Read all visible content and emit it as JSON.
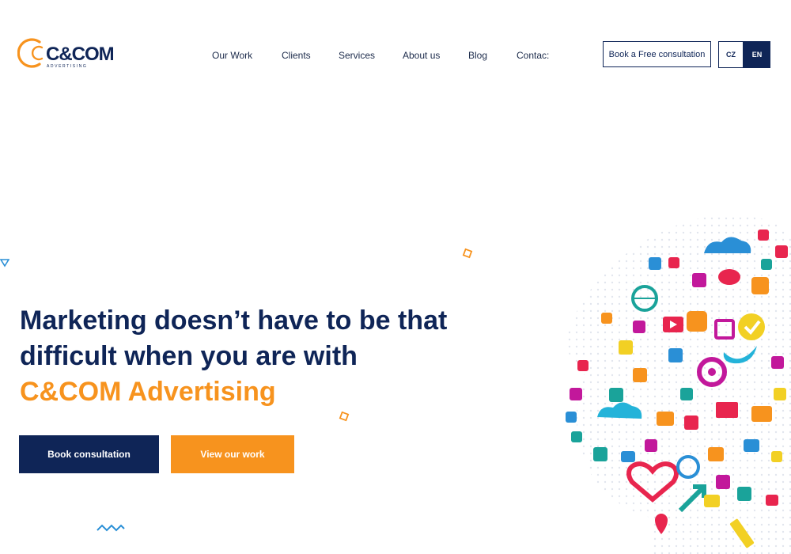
{
  "brand": {
    "name": "C&COM",
    "tagline": "ADVERTISING",
    "color": "#f7931e",
    "navy": "#0f2557"
  },
  "nav": {
    "items": [
      {
        "label": "Our Work"
      },
      {
        "label": "Clients"
      },
      {
        "label": "Services"
      },
      {
        "label": "About us"
      },
      {
        "label": "Blog"
      },
      {
        "label": "Contac:"
      }
    ]
  },
  "header": {
    "free_consultation": "Book a Free consultation",
    "lang": {
      "cz": "CZ",
      "en": "EN"
    }
  },
  "hero": {
    "line1": "Marketing doesn’t have to be that",
    "line2": "difficult when you are with",
    "line3": "C&COM Advertising",
    "book_button": "Book consultation",
    "work_button": "View our work"
  },
  "illustration": {
    "icons": [
      "cloud-icon",
      "heart-icon",
      "globe-icon",
      "twitter-icon",
      "calendar-icon",
      "chat-icon",
      "power-icon",
      "wifi-icon",
      "gear-icon",
      "cart-icon",
      "play-icon",
      "pencil-icon",
      "map-pin-icon",
      "truck-icon",
      "camera-icon",
      "mail-icon",
      "music-icon",
      "checkmark-icon"
    ]
  }
}
